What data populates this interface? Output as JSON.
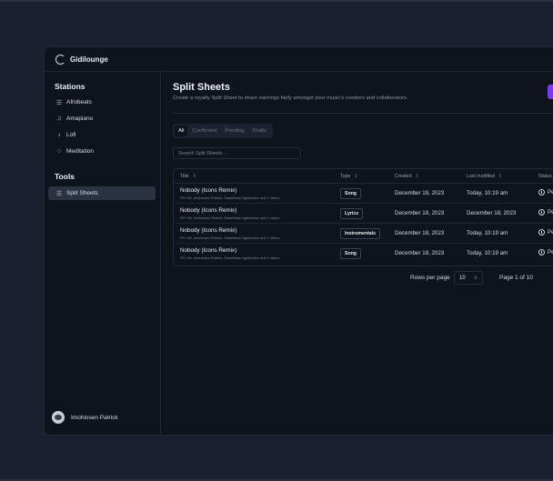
{
  "app": {
    "title": "Gidilounge"
  },
  "sidebar": {
    "stations_title": "Stations",
    "stations": [
      {
        "label": "Afrobeats",
        "icon": "playlist-icon"
      },
      {
        "label": "Amapiano",
        "icon": "music-note-icon"
      },
      {
        "label": "Lofi",
        "icon": "music-note-single-icon"
      },
      {
        "label": "Meditation",
        "icon": "circle-icon"
      }
    ],
    "tools_title": "Tools",
    "tools": [
      {
        "label": "Split Sheets",
        "icon": "playlist-icon",
        "active": true
      }
    ],
    "user": {
      "name": "Imohiosen Patrick"
    }
  },
  "main": {
    "title": "Split Sheets",
    "description": "Create a royalty Split Sheet to share earnings fairly amongst your music's creators and collaborators.",
    "tabs": [
      "All",
      "Confirmed",
      "Pending",
      "Drafts"
    ],
    "active_tab": "All",
    "search_placeholder": "Search Split Sheets...",
    "accent_color": "#7c3aed"
  },
  "table": {
    "columns": [
      "Title",
      "Type",
      "Created",
      "Last modified",
      "Status"
    ],
    "rows": [
      {
        "title": "Nobody (Icons Remix)",
        "sub": "FR: Me, Imohiosen Patrick, Olamilekan Agbeleshe and 2 others",
        "type": "Song",
        "created": "December 18, 2023",
        "modified": "Today, 10:19 am",
        "status": "Pe"
      },
      {
        "title": "Nobody (Icons Remix)",
        "sub": "FR: Me, Imohiosen Patrick, Olamilekan Agbeleshe and 2 others",
        "type": "Lyrics",
        "created": "December 18, 2023",
        "modified": "December 18, 2023",
        "status": "Pe"
      },
      {
        "title": "Nobody (Icons Remix)",
        "sub": "FR: Me, Imohiosen Patrick, Olamilekan Agbeleshe and 2 others",
        "type": "Instrumentals",
        "created": "December 18, 2023",
        "modified": "Today, 10:19 am",
        "status": "Pe"
      },
      {
        "title": "Nobody (Icons Remix)",
        "sub": "FR: Me, Imohiosen Patrick, Olamilekan Agbeleshe and 2 others",
        "type": "Song",
        "created": "December 18, 2023",
        "modified": "Today, 10:19 am",
        "status": "Pe"
      }
    ]
  },
  "pagination": {
    "rows_label": "Rows per page",
    "rows_value": "10",
    "page_info": "Page 1 of 10"
  }
}
